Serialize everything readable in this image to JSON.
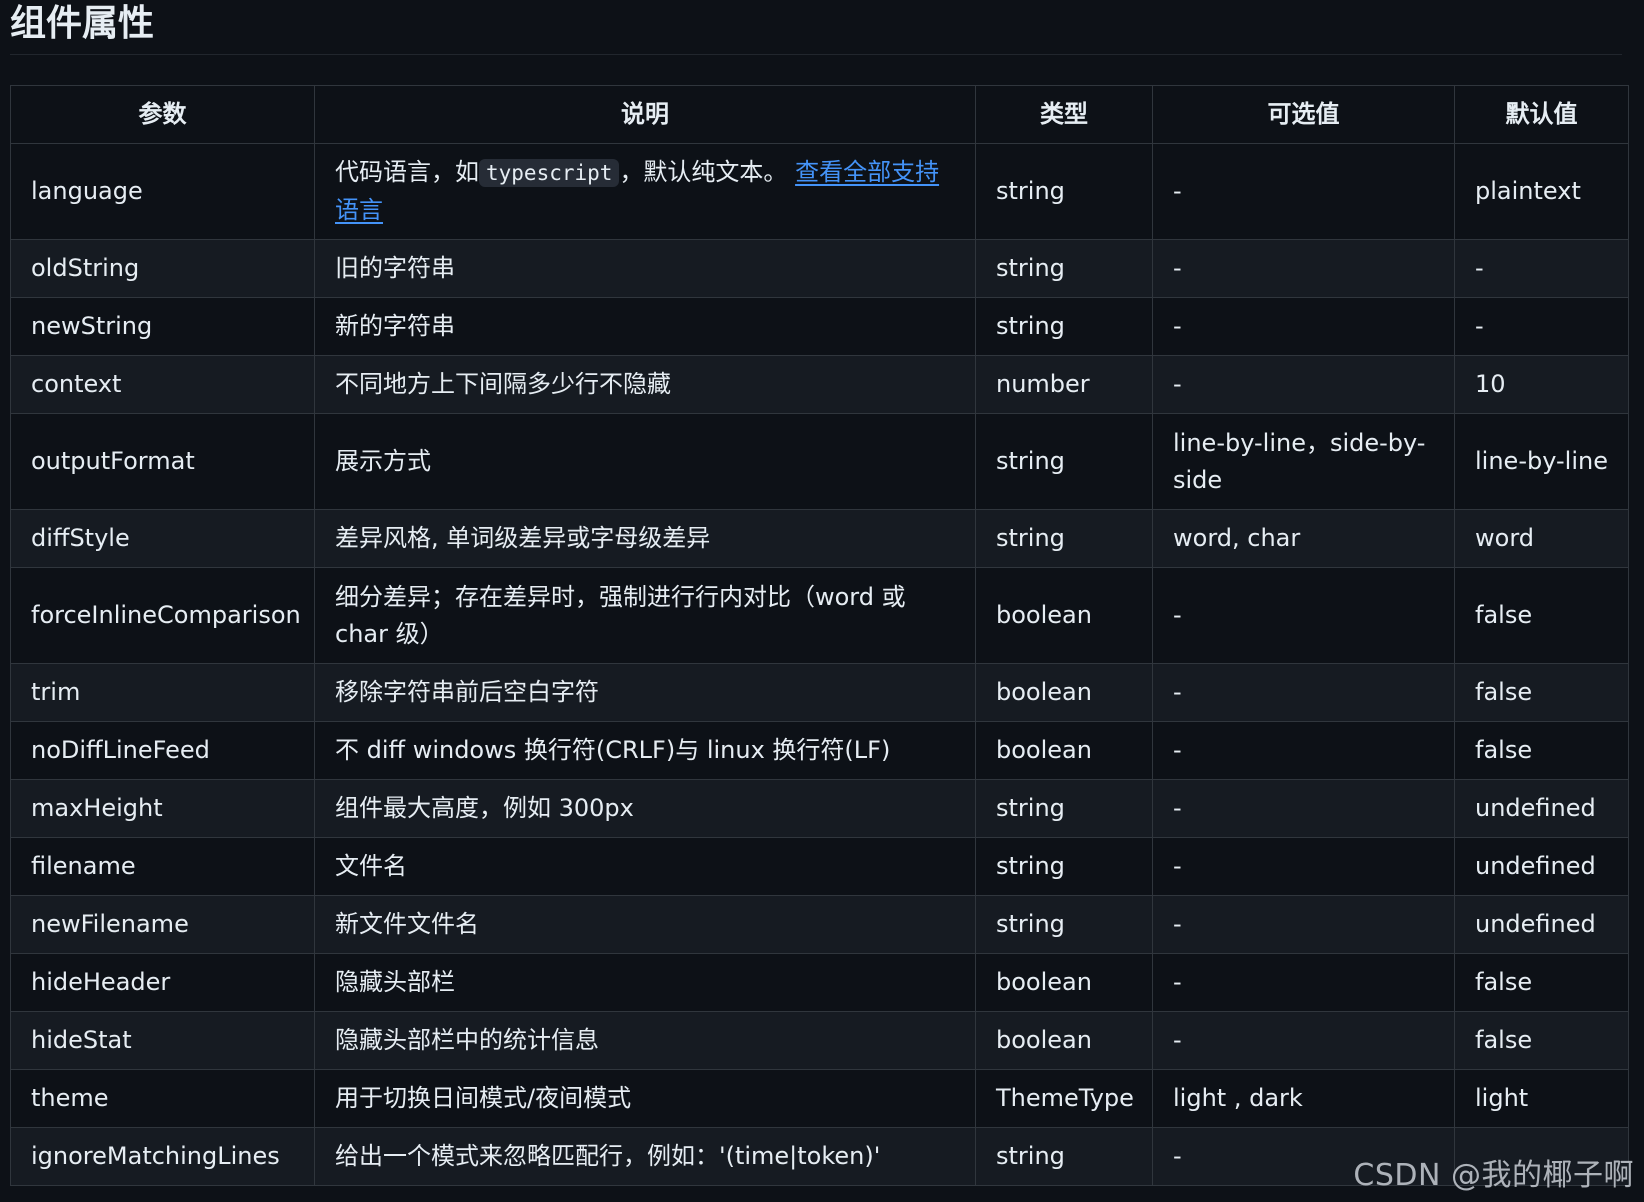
{
  "page": {
    "title": "组件属性",
    "watermark": "CSDN @我的椰子啊"
  },
  "table": {
    "headers": [
      "参数",
      "说明",
      "类型",
      "可选值",
      "默认值"
    ],
    "rows": [
      {
        "param": "language",
        "desc_before": "代码语言，如",
        "desc_code": "typescript",
        "desc_after": "，默认纯文本。",
        "desc_link": "查看全部支持语言",
        "type": "string",
        "options": "-",
        "default": "plaintext"
      },
      {
        "param": "oldString",
        "desc": "旧的字符串",
        "type": "string",
        "options": "-",
        "default": "-"
      },
      {
        "param": "newString",
        "desc": "新的字符串",
        "type": "string",
        "options": "-",
        "default": "-"
      },
      {
        "param": "context",
        "desc": "不同地方上下间隔多少行不隐藏",
        "type": "number",
        "options": "-",
        "default": "10"
      },
      {
        "param": "outputFormat",
        "desc": "展示方式",
        "type": "string",
        "options": "line-by-line，side-by-side",
        "default": "line-by-line"
      },
      {
        "param": "diffStyle",
        "desc": "差异风格, 单词级差异或字母级差异",
        "type": "string",
        "options": "word, char",
        "default": "word"
      },
      {
        "param": "forceInlineComparison",
        "desc": "细分差异；存在差异时，强制进行行内对比（word 或 char 级）",
        "type": "boolean",
        "options": "-",
        "default": "false"
      },
      {
        "param": "trim",
        "desc": "移除字符串前后空白字符",
        "type": "boolean",
        "options": "-",
        "default": "false"
      },
      {
        "param": "noDiffLineFeed",
        "desc": "不 diff windows 换行符(CRLF)与 linux 换行符(LF)",
        "type": "boolean",
        "options": "-",
        "default": "false"
      },
      {
        "param": "maxHeight",
        "desc": "组件最大高度，例如 300px",
        "type": "string",
        "options": "-",
        "default": "undefined"
      },
      {
        "param": "filename",
        "desc": "文件名",
        "type": "string",
        "options": "-",
        "default": "undefined"
      },
      {
        "param": "newFilename",
        "desc": "新文件文件名",
        "type": "string",
        "options": "-",
        "default": "undefined"
      },
      {
        "param": "hideHeader",
        "desc": "隐藏头部栏",
        "type": "boolean",
        "options": "-",
        "default": "false"
      },
      {
        "param": "hideStat",
        "desc": "隐藏头部栏中的统计信息",
        "type": "boolean",
        "options": "-",
        "default": "false"
      },
      {
        "param": "theme",
        "desc": "用于切换日间模式/夜间模式",
        "type": "ThemeType",
        "options": "light , dark",
        "default": "light"
      },
      {
        "param": "ignoreMatchingLines",
        "desc": "给出一个模式来忽略匹配行，例如：'(time|token)'",
        "type": "string",
        "options": "-",
        "default": ""
      }
    ]
  },
  "colors": {
    "background": "#0d1117",
    "row_alt": "#161b22",
    "border": "#30363d",
    "link": "#4493f8",
    "text": "#e6edf3"
  }
}
